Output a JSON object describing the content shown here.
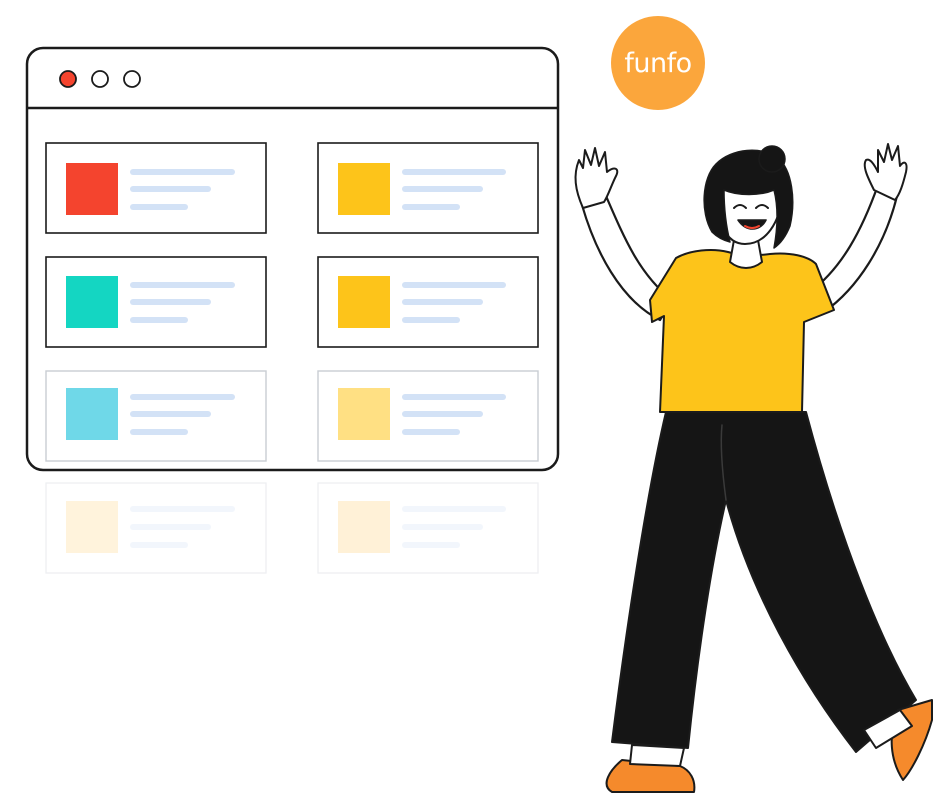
{
  "brand": {
    "logo_text": "funfo",
    "logo_color": "#FBA63C"
  },
  "window": {
    "controls": [
      {
        "name": "close",
        "color": "#F4442E"
      },
      {
        "name": "minimize",
        "color": "none"
      },
      {
        "name": "maximize",
        "color": "none"
      }
    ]
  },
  "cards": [
    {
      "thumb_color": "#F4442E",
      "row": 1,
      "col": 1
    },
    {
      "thumb_color": "#FDC41A",
      "row": 1,
      "col": 2
    },
    {
      "thumb_color": "#14D6C2",
      "row": 2,
      "col": 1
    },
    {
      "thumb_color": "#FDC41A",
      "row": 2,
      "col": 2
    },
    {
      "thumb_color": "#6FD8E8",
      "row": 3,
      "col": 1
    },
    {
      "thumb_color": "#FFE083",
      "row": 3,
      "col": 2
    },
    {
      "thumb_color": "#FFF4DA",
      "row": 4,
      "col": 1,
      "faded": true
    },
    {
      "thumb_color": "#FFF1D4",
      "row": 4,
      "col": 2,
      "faded": true
    }
  ],
  "colors": {
    "outline": "#1b1b1b",
    "text_line": "#D3E2F6",
    "shirt": "#FDC41A",
    "pants": "#151515",
    "shoes": "#F58A2C"
  },
  "icons": [
    "window-close-dot-icon",
    "window-minimize-dot-icon",
    "window-maximize-dot-icon",
    "funfo-logo-icon"
  ]
}
